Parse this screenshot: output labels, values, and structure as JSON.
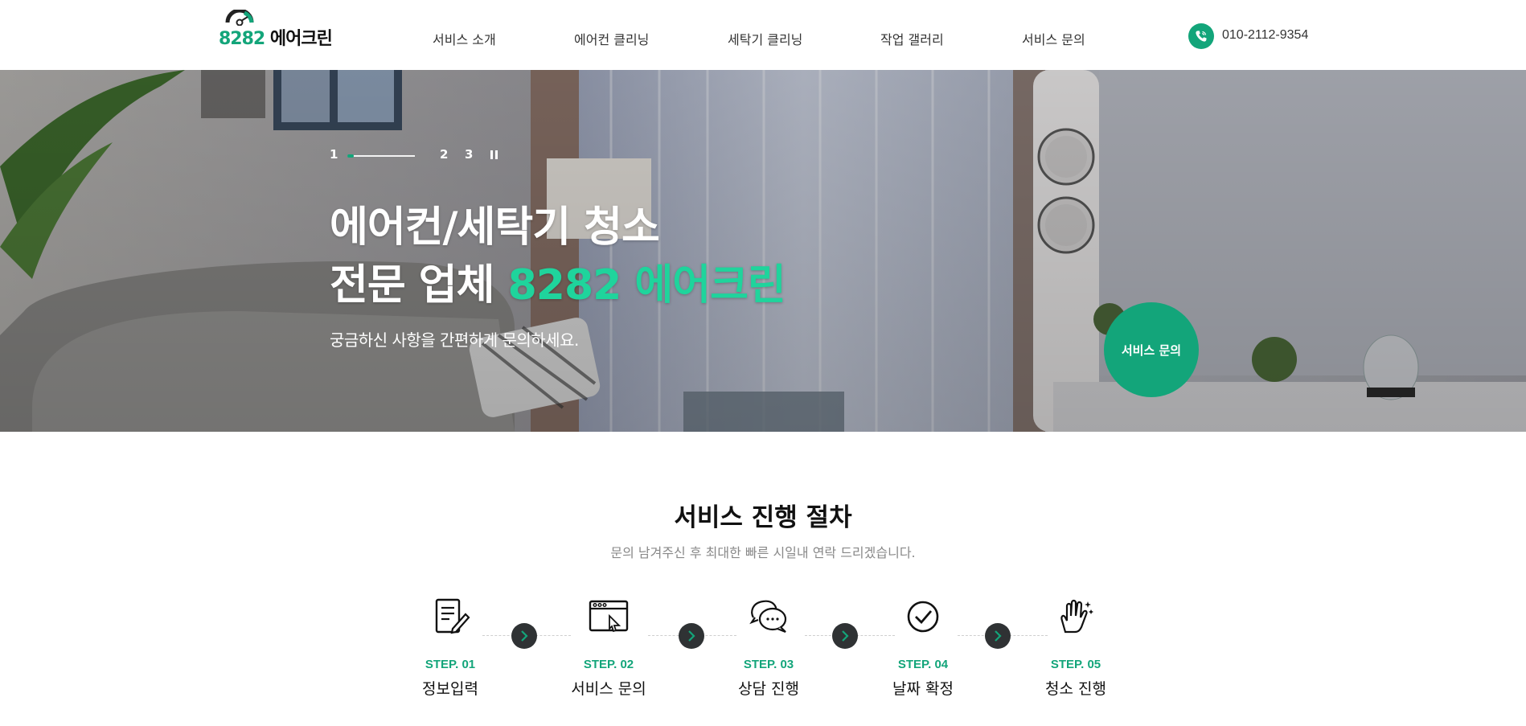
{
  "header": {
    "logo": {
      "number": "8282",
      "name": "에어크린"
    },
    "nav": [
      {
        "label": "서비스 소개"
      },
      {
        "label": "에어컨 클리닝"
      },
      {
        "label": "세탁기 클리닝"
      },
      {
        "label": "작업 갤러리"
      },
      {
        "label": "서비스 문의"
      }
    ],
    "phone": "010-2112-9354"
  },
  "hero": {
    "pager": {
      "current": "1",
      "others": [
        "2",
        "3"
      ],
      "progress": 0.1
    },
    "title_line1": "에어컨/세탁기 청소",
    "title_line2_prefix": "전문 업체 ",
    "title_line2_highlight": "8282 에어크린",
    "subtitle": "궁금하신 사항을 간편하게 문의하세요.",
    "cta_label": "서비스 문의"
  },
  "process": {
    "title": "서비스 진행 절차",
    "subtitle": "문의 남겨주신 후 최대한 빠른 시일내 연락 드리겠습니다.",
    "steps": [
      {
        "label": "STEP. 01",
        "name": "정보입력",
        "icon": "document-edit-icon"
      },
      {
        "label": "STEP. 02",
        "name": "서비스 문의",
        "icon": "browser-cursor-icon"
      },
      {
        "label": "STEP. 03",
        "name": "상담 진행",
        "icon": "chat-bubbles-icon"
      },
      {
        "label": "STEP. 04",
        "name": "날짜 확정",
        "icon": "check-circle-icon"
      },
      {
        "label": "STEP. 05",
        "name": "청소 진행",
        "icon": "cleaning-hand-icon"
      }
    ]
  },
  "colors": {
    "accent": "#13a57a",
    "hero_highlight": "#1fd49c",
    "arrow_bg": "#2f3234"
  }
}
